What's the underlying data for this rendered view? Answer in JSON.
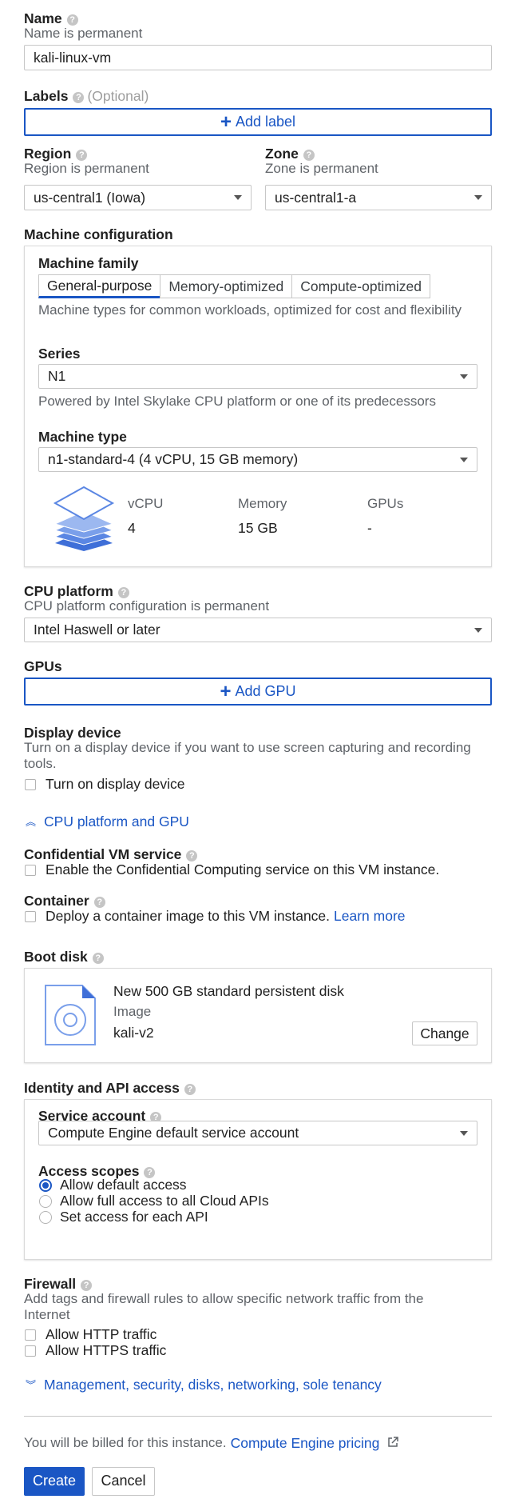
{
  "colors": {
    "accent": "#1a56c4",
    "hint": "#5f6368",
    "border": "#c7c7c7"
  },
  "name": {
    "label": "Name",
    "hint": "Name is permanent",
    "value": "kali-linux-vm"
  },
  "labels": {
    "label": "Labels",
    "optional": "(Optional)",
    "add_label": "Add label"
  },
  "region": {
    "label": "Region",
    "hint": "Region is permanent",
    "value": "us-central1 (Iowa)"
  },
  "zone": {
    "label": "Zone",
    "hint": "Zone is permanent",
    "value": "us-central1-a"
  },
  "machine": {
    "title": "Machine configuration",
    "family_label": "Machine family",
    "families": [
      "General-purpose",
      "Memory-optimized",
      "Compute-optimized"
    ],
    "selected_family": "General-purpose",
    "family_desc": "Machine types for common workloads, optimized for cost and flexibility",
    "series_label": "Series",
    "series_value": "N1",
    "series_desc": "Powered by Intel Skylake CPU platform or one of its predecessors",
    "type_label": "Machine type",
    "type_value": "n1-standard-4 (4 vCPU, 15 GB memory)",
    "specs": {
      "vcpu_label": "vCPU",
      "vcpu_value": "4",
      "memory_label": "Memory",
      "memory_value": "15 GB",
      "gpus_label": "GPUs",
      "gpus_value": "-"
    }
  },
  "cpu_platform": {
    "label": "CPU platform",
    "hint": "CPU platform configuration is permanent",
    "value": "Intel Haswell or later"
  },
  "gpus": {
    "label": "GPUs",
    "add_gpu": "Add GPU"
  },
  "display": {
    "label": "Display device",
    "desc": "Turn on a display device if you want to use screen capturing and recording tools.",
    "checkbox": "Turn on display device",
    "checked": false
  },
  "cpu_gpu_toggle": "CPU platform and GPU",
  "confidential": {
    "label": "Confidential VM service",
    "checkbox": "Enable the Confidential Computing service on this VM instance.",
    "checked": false
  },
  "container": {
    "label": "Container",
    "checkbox": "Deploy a container image to this VM instance.",
    "learn_more": "Learn more",
    "checked": false
  },
  "boot_disk": {
    "label": "Boot disk",
    "title": "New 500 GB standard persistent disk",
    "image_label": "Image",
    "image_value": "kali-v2",
    "change": "Change"
  },
  "identity": {
    "label": "Identity and API access",
    "service_account_label": "Service account",
    "service_account_value": "Compute Engine default service account",
    "scopes_label": "Access scopes",
    "scopes": [
      "Allow default access",
      "Allow full access to all Cloud APIs",
      "Set access for each API"
    ],
    "selected_scope": "Allow default access"
  },
  "firewall": {
    "label": "Firewall",
    "desc": "Add tags and firewall rules to allow specific network traffic from the Internet",
    "http": "Allow HTTP traffic",
    "https": "Allow HTTPS traffic"
  },
  "management_toggle": "Management, security, disks, networking, sole tenancy",
  "billing": {
    "text": "You will be billed for this instance.",
    "link": "Compute Engine pricing"
  },
  "actions": {
    "create": "Create",
    "cancel": "Cancel"
  }
}
